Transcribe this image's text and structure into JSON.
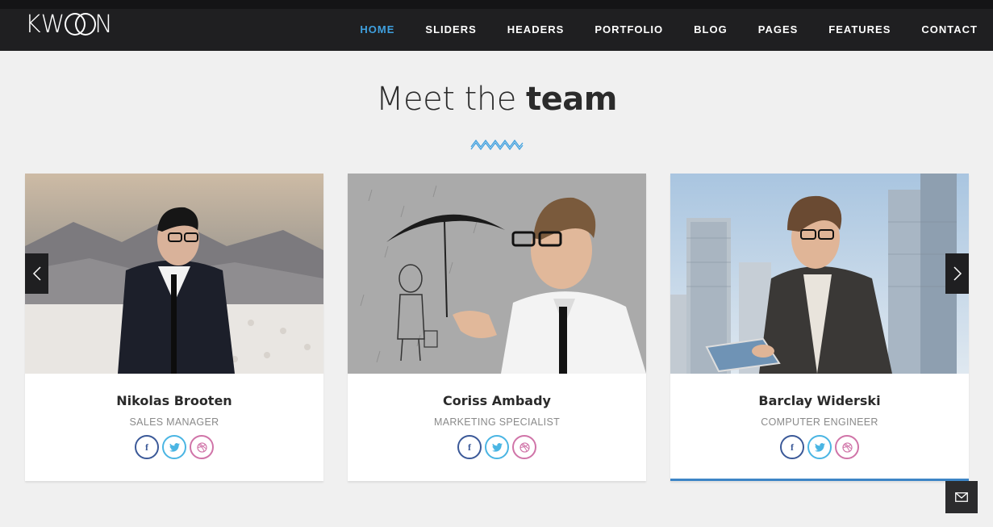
{
  "brand": {
    "logo_text": "KWOON"
  },
  "nav": {
    "items": [
      "HOME",
      "SLIDERS",
      "HEADERS",
      "PORTFOLIO",
      "BLOG",
      "PAGES",
      "FEATURES",
      "CONTACT"
    ],
    "active": "HOME"
  },
  "section": {
    "title_light": "Meet the",
    "title_bold": "team"
  },
  "team": [
    {
      "name": "Nikolas Brooten",
      "role": "SALES MANAGER"
    },
    {
      "name": "Coriss Ambady",
      "role": "MARKETING SPECIALIST"
    },
    {
      "name": "Barclay Widerski",
      "role": "COMPUTER ENGINEER"
    }
  ],
  "social_icons": {
    "facebook": "f",
    "twitter": "twitter-bird-icon",
    "dribbble": "dribbble-icon"
  },
  "colors": {
    "accent": "#3fa0df",
    "facebook": "#3b5998",
    "twitter": "#4ab5e3",
    "dribbble": "#d074a8",
    "card_active_border": "#3d85c6"
  }
}
